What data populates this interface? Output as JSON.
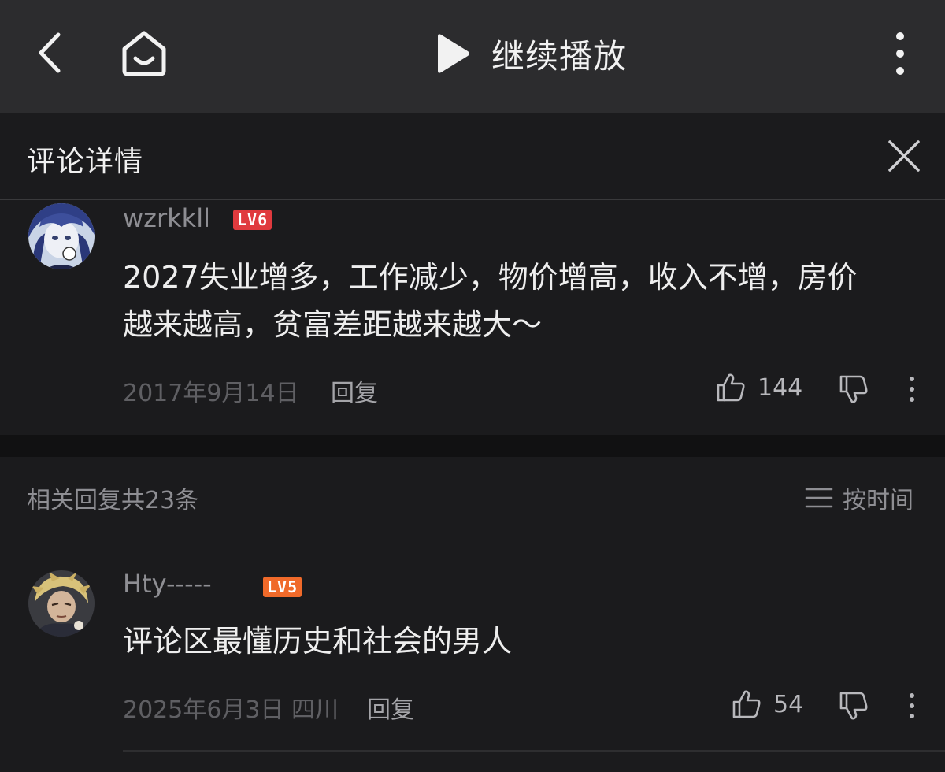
{
  "topbar": {
    "play_label": "继续播放"
  },
  "detail": {
    "title": "评论详情"
  },
  "main_comment": {
    "username": "wzrkkll",
    "level": "LV6",
    "text_line1": "2027失业增多，工作减少，物价增高，收入不增，房价",
    "text_line2": "越来越高，贫富差距越来越大～",
    "date": "2017年9月14日",
    "reply_label": "回复",
    "likes": "144"
  },
  "replies": {
    "count_label": "相关回复共23条",
    "sort_label": "按时间",
    "items": [
      {
        "username": "Hty-----",
        "level": "LV5",
        "text": "评论区最懂历史和社会的男人",
        "date": "2025年6月3日 四川",
        "reply_label": "回复",
        "likes": "54"
      }
    ]
  },
  "colors": {
    "lv6": "#e03a3e",
    "lv5": "#f06a2a",
    "background": "#1b1b1d",
    "topbar": "#2c2c2e"
  },
  "icons": [
    "back-icon",
    "home-icon",
    "play-icon",
    "more-vertical-icon",
    "close-icon",
    "thumb-up-icon",
    "thumb-down-icon",
    "list-icon"
  ]
}
